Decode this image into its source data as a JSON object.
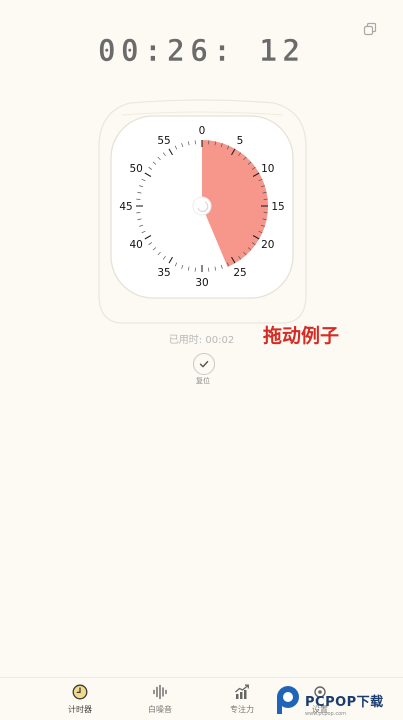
{
  "timer": {
    "display": "00:26: 12",
    "set_minutes": 26.2,
    "dial_labels": [
      "0",
      "5",
      "10",
      "15",
      "20",
      "25",
      "30",
      "35",
      "40",
      "45",
      "50",
      "55"
    ]
  },
  "elapsed_text": "已用时: 00:02",
  "annotation": "拖动例子",
  "reset_label": "复位",
  "tabs": [
    {
      "label": "计时器",
      "icon": "timer-icon",
      "active": true
    },
    {
      "label": "白噪音",
      "icon": "sound-wave-icon",
      "active": false
    },
    {
      "label": "专注力",
      "icon": "trend-chart-icon",
      "active": false
    },
    {
      "label": "设置",
      "icon": "settings-icon",
      "active": false
    }
  ],
  "watermark": {
    "text": "PCPOP下载",
    "sub": "www.pcpop.com"
  },
  "colors": {
    "accent": "#f7968a",
    "background": "#fcfaf3",
    "annotation": "#d52b24"
  }
}
